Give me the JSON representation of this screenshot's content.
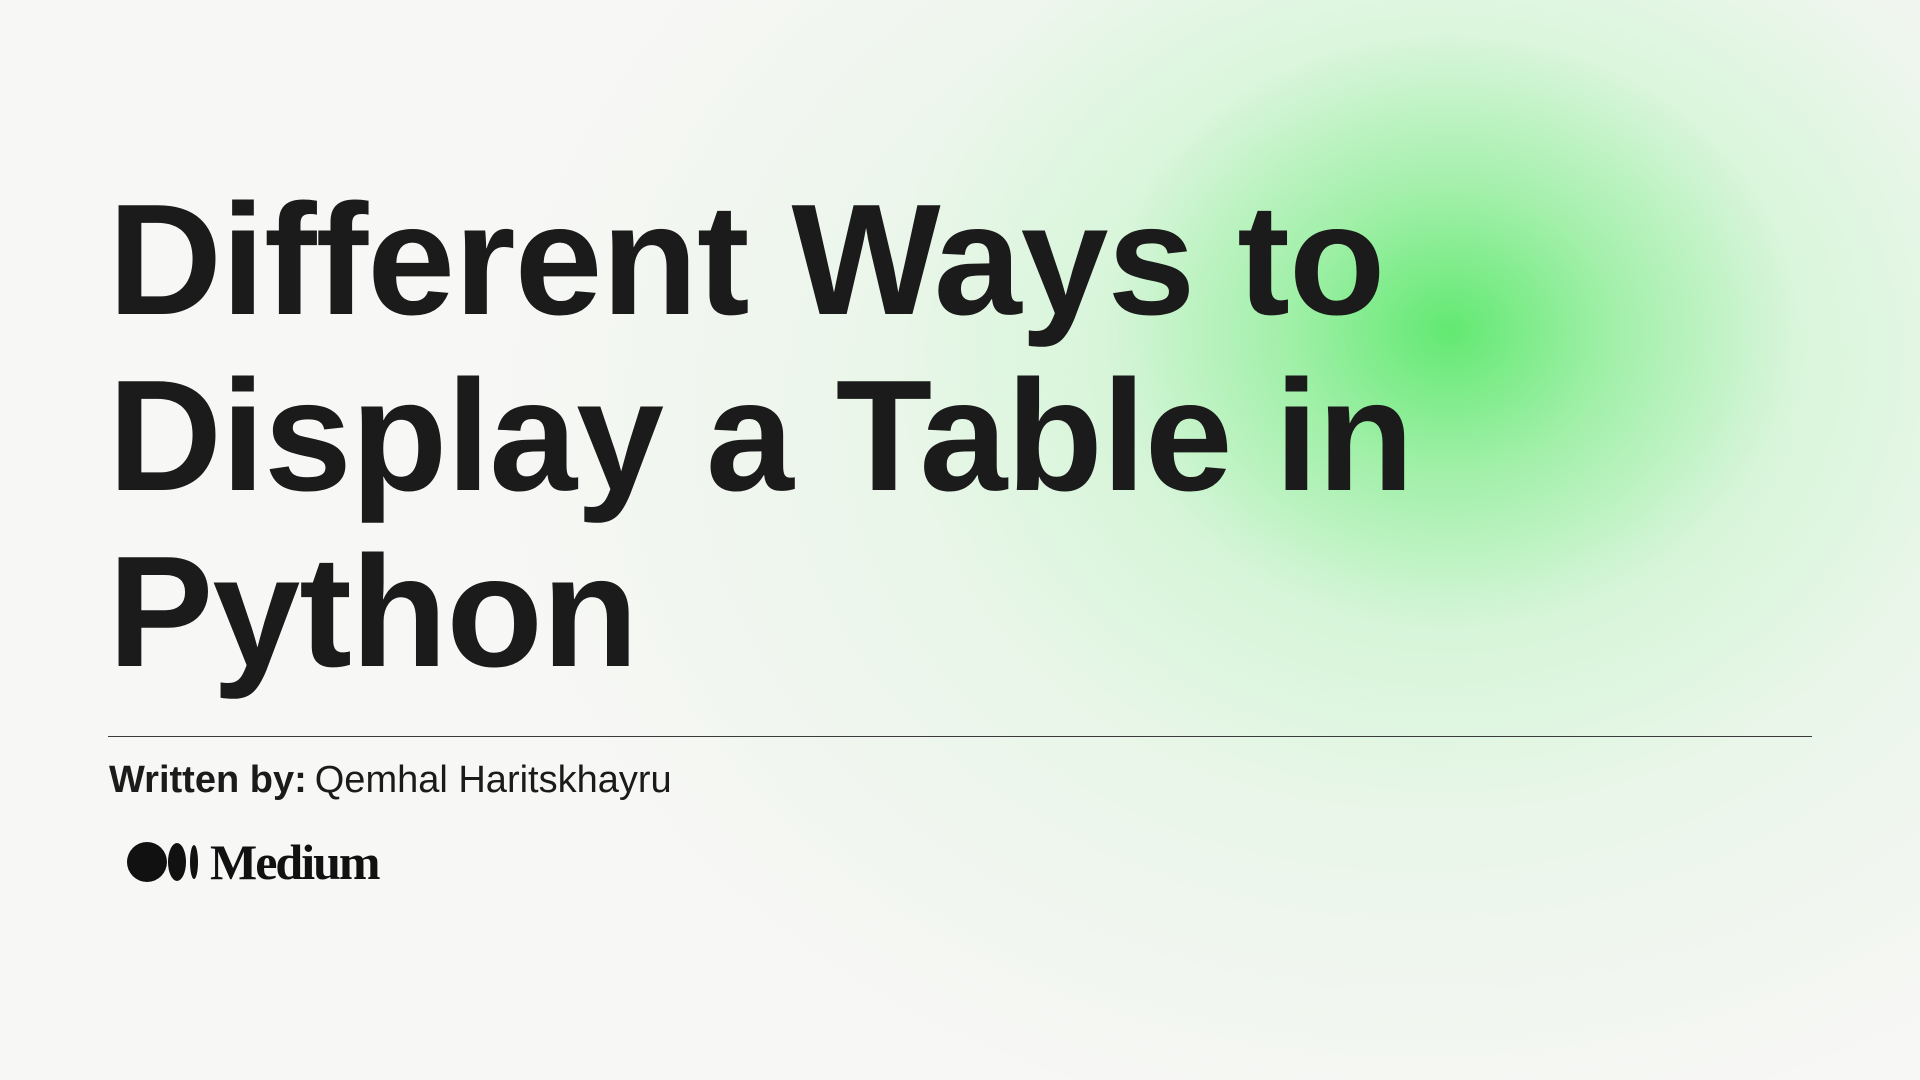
{
  "title": {
    "lines": [
      "Different Ways to",
      "Display a Table in",
      "Python"
    ]
  },
  "byline": {
    "label": "Written by:",
    "author": "Qemhal Haritskhayru"
  },
  "brand": {
    "name": "Medium",
    "icon": "medium-logo-icon"
  },
  "colors": {
    "background": "#f7f7f5",
    "accent_glow": "#5ce86c",
    "text": "#1b1b1b"
  }
}
